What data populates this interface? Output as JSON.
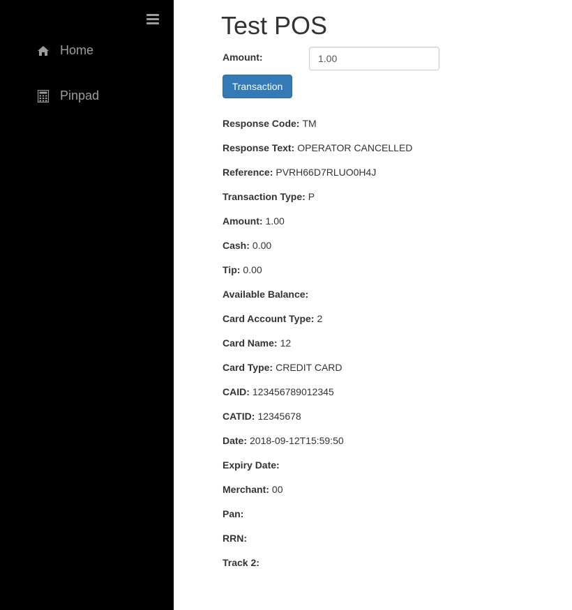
{
  "sidebar": {
    "items": [
      {
        "label": "Home",
        "icon": "home-icon"
      },
      {
        "label": "Pinpad",
        "icon": "calculator-icon"
      }
    ]
  },
  "main": {
    "title": "Test POS",
    "amount_label": "Amount:",
    "amount_value": "1.00",
    "transaction_button": "Transaction",
    "fields": [
      {
        "label": "Response Code:",
        "value": "TM"
      },
      {
        "label": "Response Text:",
        "value": "OPERATOR CANCELLED"
      },
      {
        "label": "Reference:",
        "value": "PVRH66D7RLUO0H4J"
      },
      {
        "label": "Transaction Type:",
        "value": "P"
      },
      {
        "label": "Amount:",
        "value": "1.00"
      },
      {
        "label": "Cash:",
        "value": "0.00"
      },
      {
        "label": "Tip:",
        "value": "0.00"
      },
      {
        "label": "Available Balance:",
        "value": ""
      },
      {
        "label": "Card Account Type:",
        "value": "2"
      },
      {
        "label": "Card Name:",
        "value": "12"
      },
      {
        "label": "Card Type:",
        "value": "CREDIT CARD"
      },
      {
        "label": "CAID:",
        "value": "123456789012345"
      },
      {
        "label": "CATID:",
        "value": "12345678"
      },
      {
        "label": "Date:",
        "value": "2018-09-12T15:59:50"
      },
      {
        "label": "Expiry Date:",
        "value": ""
      },
      {
        "label": "Merchant:",
        "value": "00"
      },
      {
        "label": "Pan:",
        "value": ""
      },
      {
        "label": "RRN:",
        "value": ""
      },
      {
        "label": "Track 2:",
        "value": ""
      }
    ]
  },
  "colors": {
    "sidebar_bg": "#000000",
    "sidebar_text": "#9d9d9d",
    "button_primary": "#337ab7",
    "text": "#333333"
  }
}
